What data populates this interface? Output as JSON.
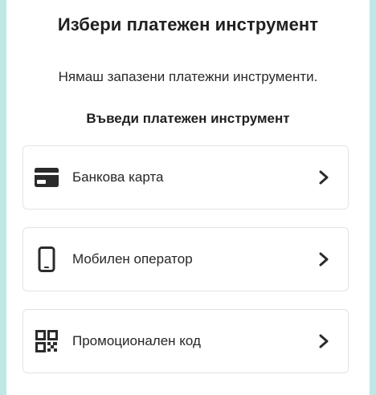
{
  "header": {
    "title": "Избери платежен инструмент",
    "no_saved_message": "Нямаш запазени платежни инструменти."
  },
  "section": {
    "title": "Въведи платежен инструмент"
  },
  "options": [
    {
      "label": "Банкова карта",
      "icon": "credit-card-icon"
    },
    {
      "label": "Мобилен оператор",
      "icon": "smartphone-icon"
    },
    {
      "label": "Промоционален код",
      "icon": "qr-code-icon"
    }
  ],
  "colors": {
    "backdrop": "#bfe7e6",
    "surface": "#ffffff",
    "border": "#e3e3e3",
    "text": "#202020"
  }
}
